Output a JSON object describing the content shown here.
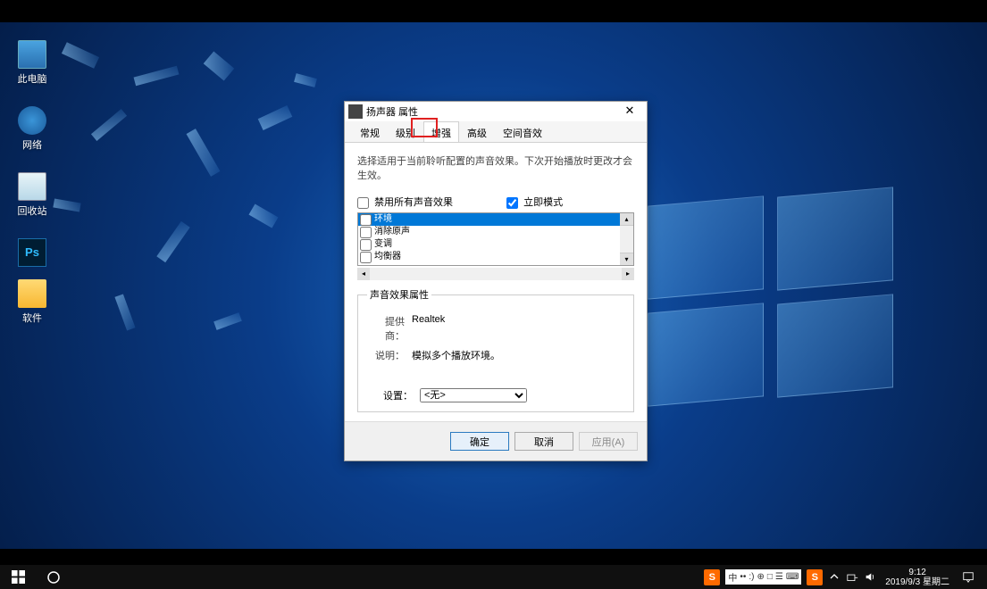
{
  "desktop_icons": [
    {
      "name": "thispc-icon",
      "label": "此电脑"
    },
    {
      "name": "network-icon",
      "label": "网络"
    },
    {
      "name": "recyclebin-icon",
      "label": "回收站"
    },
    {
      "name": "photoshop-icon",
      "label": "Ps"
    },
    {
      "name": "software-folder-icon",
      "label": "软件"
    }
  ],
  "dialog": {
    "title": "扬声器 属性",
    "tabs": [
      "常规",
      "级别",
      "增强",
      "高级",
      "空间音效"
    ],
    "active_tab_index": 2,
    "description": "选择适用于当前聆听配置的声音效果。下次开始播放时更改才会生效。",
    "disable_all_label": "禁用所有声音效果",
    "disable_all_checked": false,
    "immediate_mode_label": "立即模式",
    "immediate_mode_checked": true,
    "effects": [
      {
        "label": "环境",
        "checked": false,
        "selected": true
      },
      {
        "label": "消除原声",
        "checked": false,
        "selected": false
      },
      {
        "label": "变调",
        "checked": false,
        "selected": false
      },
      {
        "label": "均衡器",
        "checked": false,
        "selected": false
      }
    ],
    "props_legend": "声音效果属性",
    "provider_label": "提供商：",
    "provider_value": "Realtek",
    "desc_label": "说明：",
    "desc_value": "模拟多个播放环境。",
    "setting_label": "设置：",
    "setting_value": "<无>",
    "buttons": {
      "ok": "确定",
      "cancel": "取消",
      "apply": "应用(A)"
    }
  },
  "taskbar": {
    "ime_symbols": [
      "中",
      "••",
      ":)",
      "⊕",
      "□",
      "☰",
      "⌨"
    ],
    "clock_time": "9:12",
    "clock_date": "2019/9/3 星期二"
  }
}
